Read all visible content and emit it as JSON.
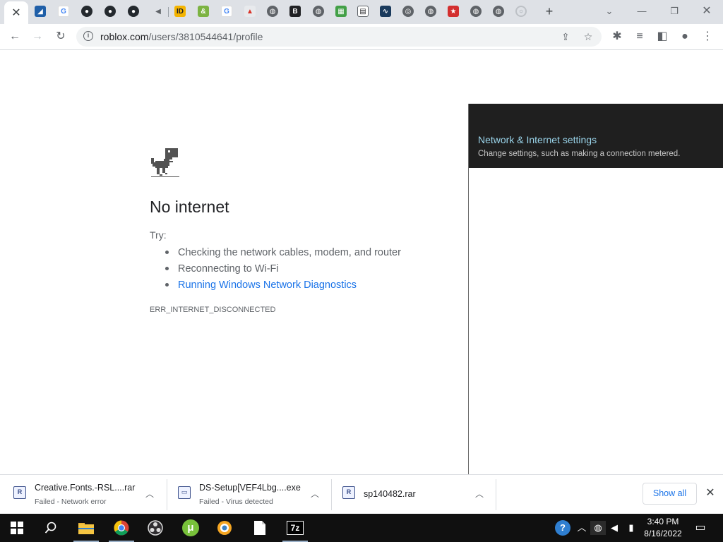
{
  "browser": {
    "url_domain": "roblox.com",
    "url_path": "/users/3810544641/profile",
    "tabs": [
      {
        "icon": "close-icon",
        "active": true
      },
      {
        "icon": "sigma-icon"
      },
      {
        "icon": "google-icon"
      },
      {
        "icon": "github-icon"
      },
      {
        "icon": "github-icon"
      },
      {
        "icon": "github-icon"
      },
      {
        "icon": "speaker-icon"
      },
      {
        "icon": "id-icon"
      },
      {
        "icon": "ampersand-icon"
      },
      {
        "icon": "google-icon"
      },
      {
        "icon": "paint-icon"
      },
      {
        "icon": "globe-icon"
      },
      {
        "icon": "b-icon"
      },
      {
        "icon": "globe-icon"
      },
      {
        "icon": "windows-icon"
      },
      {
        "icon": "card-icon"
      },
      {
        "icon": "pulse-icon"
      },
      {
        "icon": "chrome-icon"
      },
      {
        "icon": "globe-icon"
      },
      {
        "icon": "star-badge-icon"
      },
      {
        "icon": "globe-icon"
      },
      {
        "icon": "globe-icon"
      },
      {
        "icon": "loading-icon"
      }
    ]
  },
  "error_page": {
    "title": "No internet",
    "try_label": "Try:",
    "suggestions": [
      "Checking the network cables, modem, and router",
      "Reconnecting to Wi-Fi"
    ],
    "diagnostics_link": "Running Windows Network Diagnostics",
    "error_code": "ERR_INTERNET_DISCONNECTED"
  },
  "network_flyout": {
    "link": "Network & Internet settings",
    "subtitle": "Change settings, such as making a connection metered."
  },
  "downloads": {
    "items": [
      {
        "name": "Creative.Fonts.-RSL....rar",
        "status": "Failed - Network error",
        "icon": "rar-file-icon"
      },
      {
        "name": "DS-Setup[VEF4Lbg....exe",
        "status": "Failed - Virus detected",
        "icon": "exe-file-icon"
      },
      {
        "name": "sp140482.rar",
        "status": "",
        "icon": "rar-file-icon"
      }
    ],
    "show_all": "Show all"
  },
  "taskbar": {
    "time": "3:40 PM",
    "date": "8/16/2022",
    "apps": [
      "windows-start-icon",
      "search-icon",
      "file-explorer-icon",
      "chrome-icon",
      "obs-icon",
      "utorrent-icon",
      "shield-browser-icon",
      "document-icon",
      "7zip-icon"
    ],
    "seven_zip_label": "7z",
    "utorrent_label": "μ"
  },
  "colors": {
    "link": "#1a73e8",
    "flyout_header": "#1f1f1f",
    "flyout_link": "#9ad4ea",
    "taskbar": "#101010"
  }
}
